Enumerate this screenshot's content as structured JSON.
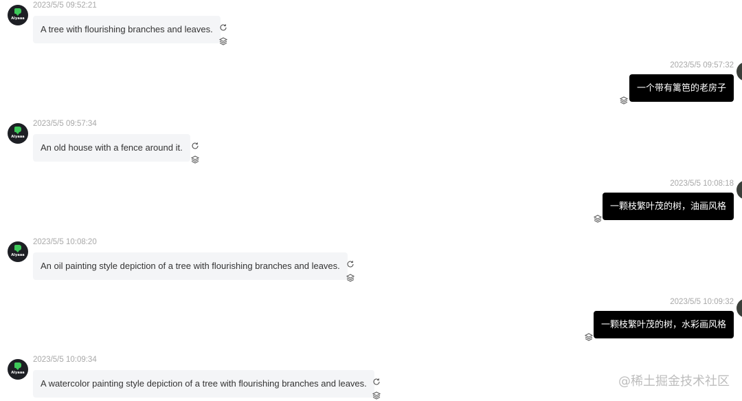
{
  "avatar_label": "Alyaaa",
  "messages": [
    {
      "role": "bot",
      "time": "2023/5/5 09:52:21",
      "text": "A tree with flourishing branches and leaves."
    },
    {
      "role": "user",
      "time": "2023/5/5 09:57:32",
      "text": "一个带有篱笆的老房子"
    },
    {
      "role": "bot",
      "time": "2023/5/5 09:57:34",
      "text": "An old house with a fence around it."
    },
    {
      "role": "user",
      "time": "2023/5/5 10:08:18",
      "text": "一颗枝繁叶茂的树，油画风格"
    },
    {
      "role": "bot",
      "time": "2023/5/5 10:08:20",
      "text": "An oil painting style depiction of a tree with flourishing branches and leaves."
    },
    {
      "role": "user",
      "time": "2023/5/5 10:09:32",
      "text": "一颗枝繁叶茂的树，水彩画风格"
    },
    {
      "role": "bot",
      "time": "2023/5/5 10:09:34",
      "text": "A watercolor painting style depiction of a tree with flourishing branches and leaves."
    }
  ],
  "watermark": "@稀土掘金技术社区",
  "icons": {
    "regenerate": "refresh-icon",
    "layers": "layers-icon",
    "bot_avatar": "bot-avatar",
    "user_avatar": "user-avatar"
  }
}
